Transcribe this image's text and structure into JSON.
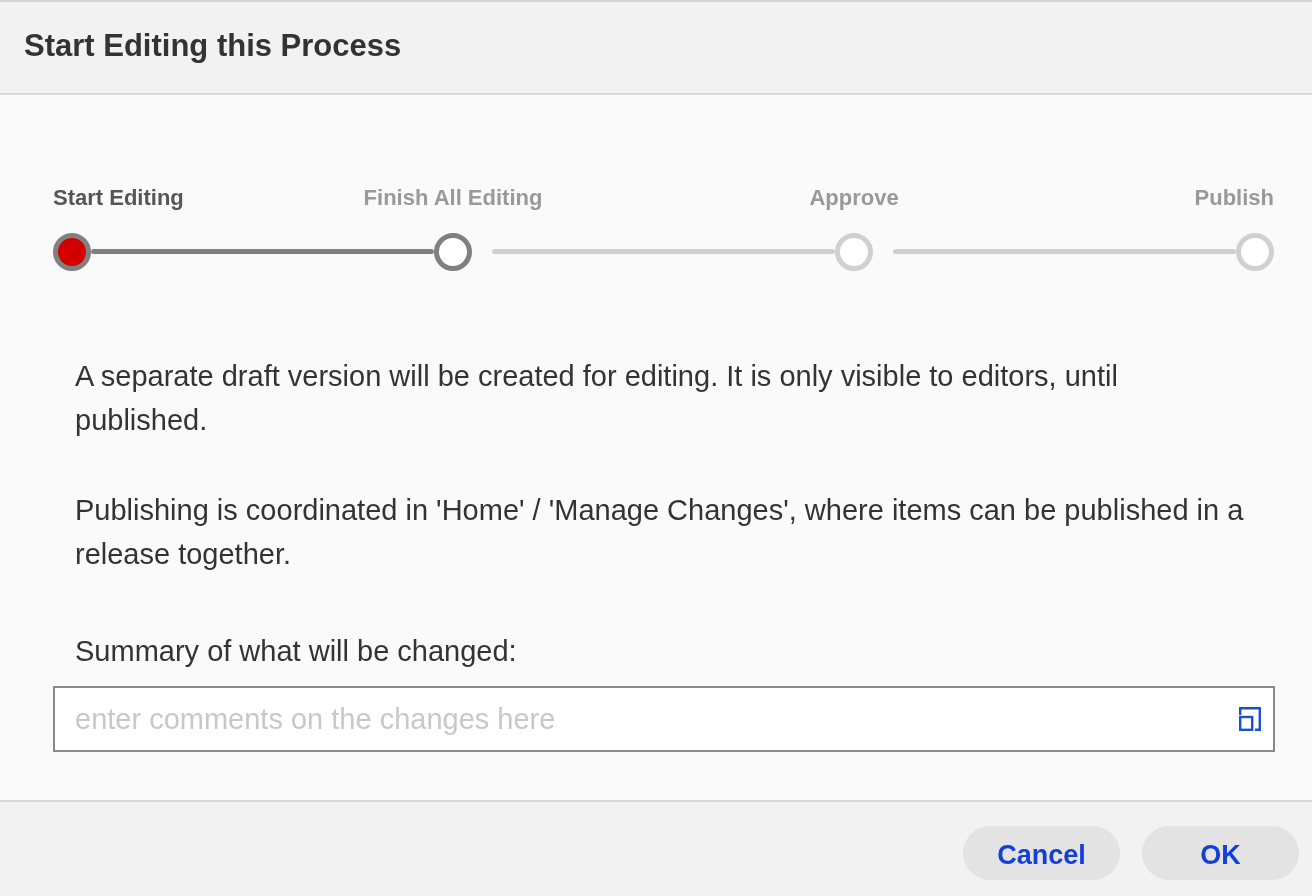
{
  "dialog": {
    "title": "Start Editing this Process"
  },
  "steps": [
    {
      "label": "Start Editing",
      "selected": true,
      "reached": true
    },
    {
      "label": "Finish All Editing",
      "selected": false,
      "reached": true
    },
    {
      "label": "Approve",
      "selected": false,
      "reached": false
    },
    {
      "label": "Publish",
      "selected": false,
      "reached": false
    }
  ],
  "paragraphs": [
    "A separate draft version will be created for editing. It is only visible to editors, until published.",
    "Publishing is coordinated in 'Home' / 'Manage Changes', where items can be published in a release together."
  ],
  "summary": {
    "label": "Summary of what will be changed:",
    "placeholder": "enter comments on the changes here"
  },
  "buttons": [
    {
      "label": "Cancel"
    },
    {
      "label": "OK"
    }
  ]
}
